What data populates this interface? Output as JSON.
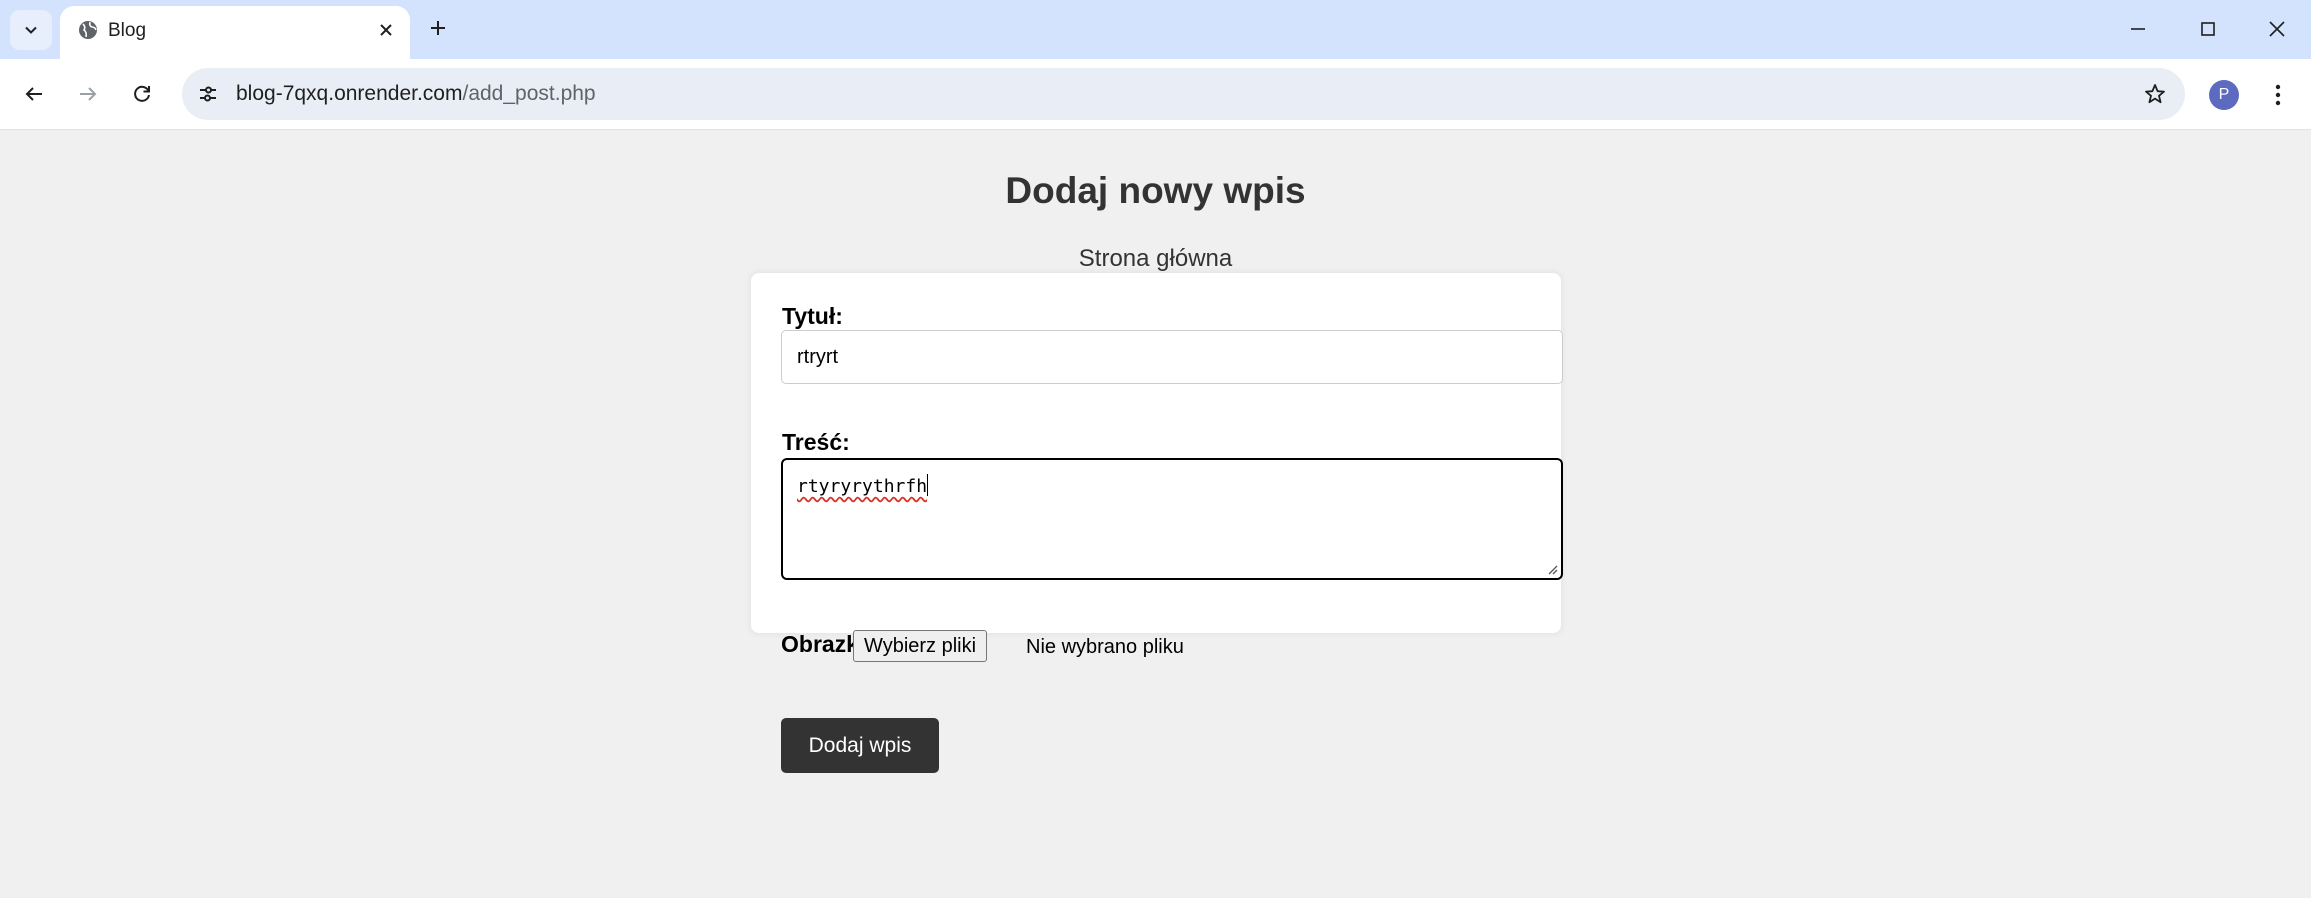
{
  "browser": {
    "tab_title": "Blog",
    "url_host": "blog-7qxq.onrender.com",
    "url_path": "/add_post.php",
    "profile_initial": "P"
  },
  "page": {
    "heading": "Dodaj nowy wpis",
    "home_link": "Strona główna",
    "form": {
      "title_label": "Tytuł:",
      "title_value": "rtryrt",
      "content_label": "Treść:",
      "content_value": "rtyryrythrfh",
      "images_label": "Obrazki:",
      "file_button_label": "Wybierz pliki",
      "file_status": "Nie wybrano pliku",
      "submit_label": "Dodaj wpis"
    }
  },
  "colors": {
    "tabbar_bg": "#d3e3fd",
    "page_bg": "#f0f0f0",
    "text_dark": "#333333",
    "submit_bg": "#333333",
    "avatar_bg": "#5c6bc0",
    "spellcheck_underline": "#d93025"
  },
  "icons": {
    "tab_list": "chevron-down-icon",
    "favicon": "globe-icon",
    "tab_close": "close-icon",
    "new_tab": "plus-icon",
    "back": "arrow-left-icon",
    "forward": "arrow-right-icon",
    "reload": "reload-icon",
    "site_info": "tune-icon",
    "bookmark": "star-icon",
    "menu": "more-vert-icon"
  }
}
